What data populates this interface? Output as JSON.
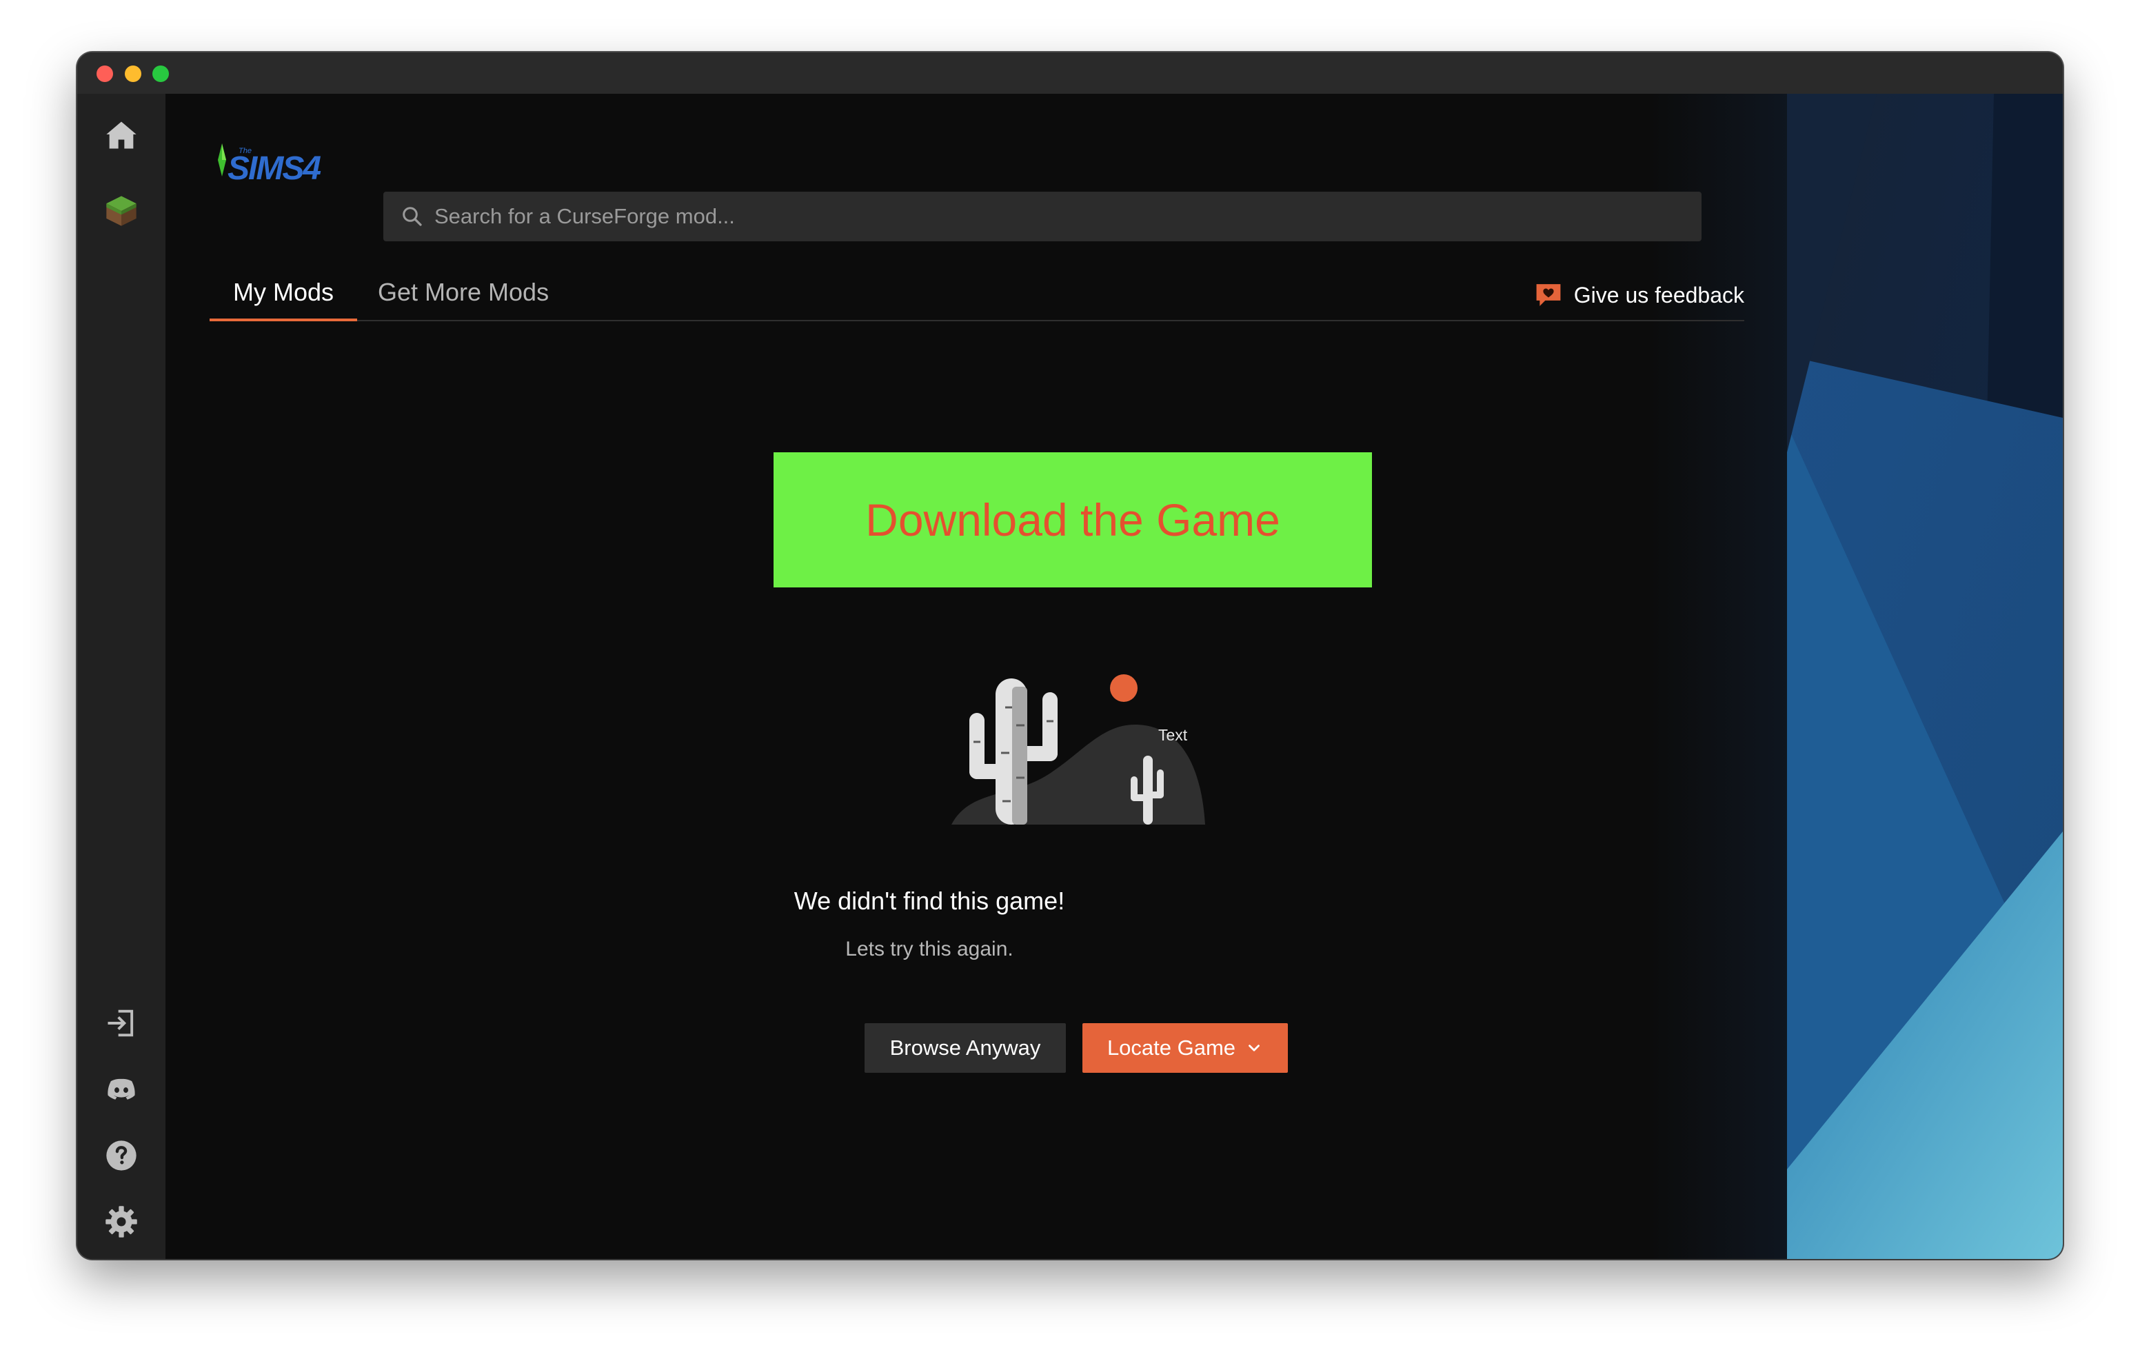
{
  "window": {
    "controls": [
      "close",
      "minimize",
      "zoom"
    ]
  },
  "sidebar": {
    "top_icons": [
      "home-icon",
      "minecraft-grass-block-icon"
    ],
    "bottom_icons": [
      "login-icon",
      "discord-icon",
      "help-icon",
      "settings-icon"
    ]
  },
  "header": {
    "game_logo": {
      "small_text": "The",
      "text": "SIMS4"
    },
    "search_placeholder": "Search for a CurseForge mod..."
  },
  "tabs": [
    {
      "label": "My Mods",
      "active": true
    },
    {
      "label": "Get More Mods",
      "active": false
    }
  ],
  "feedback": {
    "label": "Give us feedback"
  },
  "banner": {
    "label": "Download the Game",
    "background": "#6ef046",
    "text_color": "#e5502f"
  },
  "illustration": {
    "label": "Text"
  },
  "empty_state": {
    "title": "We didn't find this game!",
    "subtitle": "Lets try this again."
  },
  "actions": {
    "browse_label": "Browse Anyway",
    "locate_label": "Locate Game"
  },
  "colors": {
    "accent": "#e5643a",
    "background": "#0c0c0c",
    "sidebar": "#212121"
  }
}
